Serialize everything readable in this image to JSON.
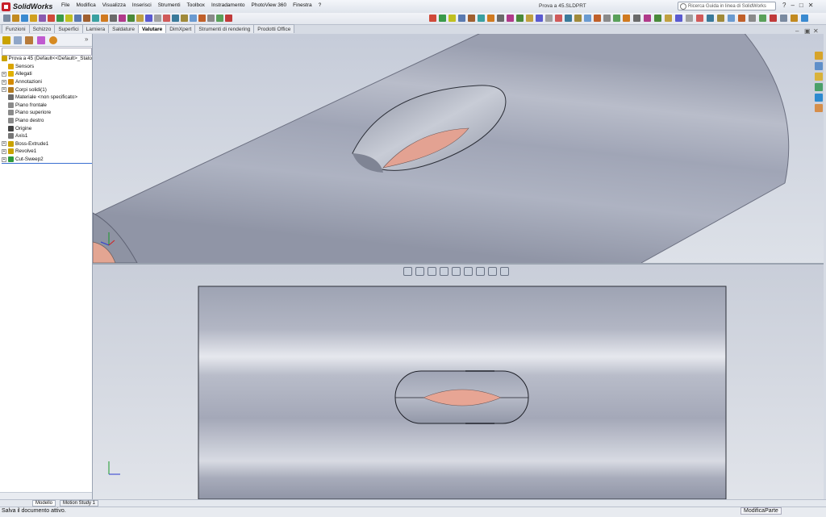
{
  "app": {
    "name": "SolidWorks",
    "document_title": "Prova a 45.SLDPRT",
    "menu": [
      "File",
      "Modifica",
      "Visualizza",
      "Inserisci",
      "Strumenti",
      "Toolbox",
      "Instradamento",
      "PhotoView 360",
      "Finestra",
      "?"
    ],
    "search_placeholder": "Ricerca Guida in linea di SolidWorks"
  },
  "command_tabs": [
    "Funzioni",
    "Schizzo",
    "Superfici",
    "Lamiera",
    "Saldature",
    "Valutare",
    "DimXpert",
    "Strumenti di rendering",
    "Prodotti Office"
  ],
  "active_tab": "Valutare",
  "tree": {
    "root": "Prova a 45  (Default<<Default>_Stato",
    "items": [
      {
        "label": "Sensors",
        "expand": false,
        "color": "#d9a400"
      },
      {
        "label": "Allegati",
        "expand": true,
        "color": "#e0b000"
      },
      {
        "label": "Annotazioni",
        "expand": true,
        "color": "#d48a00"
      },
      {
        "label": "Corpi solidi(1)",
        "expand": true,
        "color": "#b07a20"
      },
      {
        "label": "Materiale <non specificato>",
        "expand": false,
        "color": "#6a6a6a"
      },
      {
        "label": "Piano frontale",
        "expand": false,
        "color": "#8a8a8a"
      },
      {
        "label": "Piano superiore",
        "expand": false,
        "color": "#8a8a8a"
      },
      {
        "label": "Piano destro",
        "expand": false,
        "color": "#8a8a8a"
      },
      {
        "label": "Origine",
        "expand": false,
        "color": "#444444"
      },
      {
        "label": "Axis1",
        "expand": false,
        "color": "#777777"
      },
      {
        "label": "Boss-Extrude1",
        "expand": true,
        "color": "#c9a200"
      },
      {
        "label": "Revolve1",
        "expand": true,
        "color": "#c9a200"
      },
      {
        "label": "Cut-Sweep2",
        "expand": true,
        "color": "#2e9a3c"
      }
    ]
  },
  "bottom_tabs": [
    "Modello",
    "Motion Study 1"
  ],
  "status": {
    "left": "Salva il documento attivo.",
    "right": "ModificaParte"
  },
  "colors": {
    "model_gray": "#a4a9b9",
    "cut_face": "#e6a291",
    "viewport_bg": "#d3d8e2"
  },
  "icons": {
    "view_toolbar": [
      "zoom-fit-icon",
      "zoom-area-icon",
      "previous-view-icon",
      "section-view-icon",
      "view-orientation-icon",
      "display-style-icon",
      "hide-show-icon",
      "edit-appearance-icon",
      "scene-icon"
    ],
    "task_pane": [
      "home-icon",
      "resources-icon",
      "library-icon",
      "file-explorer-icon",
      "appearances-icon",
      "custom-props-icon"
    ]
  }
}
